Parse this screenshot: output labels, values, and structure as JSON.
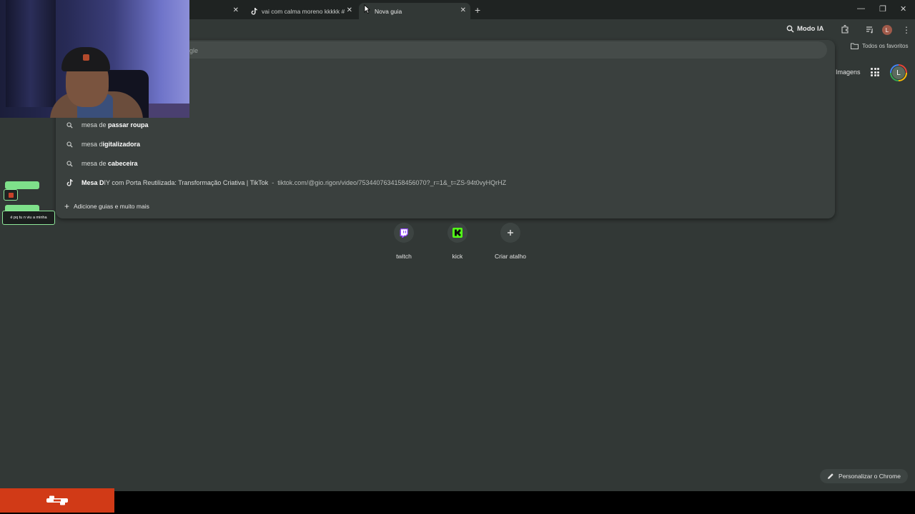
{
  "tabs": [
    {
      "title": "",
      "has_close": true
    },
    {
      "title": "vai com calma moreno kkkkk #",
      "icon": "tiktok-icon"
    },
    {
      "title": "Nova guia",
      "active": true
    }
  ],
  "toolbar": {
    "modo_ia_label": "Modo IA",
    "avatar_letter": "L"
  },
  "bookmarks": {
    "all_favorites_label": "Todos os favoritos"
  },
  "ntp_header": {
    "images_label": "Imagens",
    "account_letter": "L"
  },
  "omnibox": {
    "placeholder_visible": "gle",
    "suggestions": [
      {
        "prefix": "mesa d",
        "mid": "e ",
        "bold": "passar roupa"
      },
      {
        "prefix": "mesa d",
        "mid": "",
        "bold": "igitalizadora"
      },
      {
        "prefix": "mesa d",
        "mid": "e ",
        "bold": "cabeceira"
      }
    ],
    "history_result": {
      "title_bold": "Mesa D",
      "title_rest": "IY com Porta Reutilizada: Transformação Criativa | TikTok",
      "separator": "-",
      "url": "tiktok.com/@gio.rigon/video/7534407634158456070?_r=1&_t=ZS-94t0vyHQrHZ"
    },
    "add_more_label": "Adicione guias e muito mais"
  },
  "shortcuts": [
    {
      "label": "twitch",
      "icon": "twitch-icon",
      "color": "#9146ff"
    },
    {
      "label": "kick",
      "icon": "kick-icon",
      "color": "#53fc18"
    },
    {
      "label": "Criar atalho",
      "icon": "plus-icon"
    }
  ],
  "overlay": {
    "message_text": "é pq tu n viu a minha"
  },
  "customize_label": "Personalizar o Chrome",
  "colors": {
    "page_bg": "#323836",
    "tabstrip_bg": "#1f2322",
    "dropdown_bg": "#3a403e",
    "overlay_red": "#d13a17",
    "chat_green": "#7ee08a"
  }
}
